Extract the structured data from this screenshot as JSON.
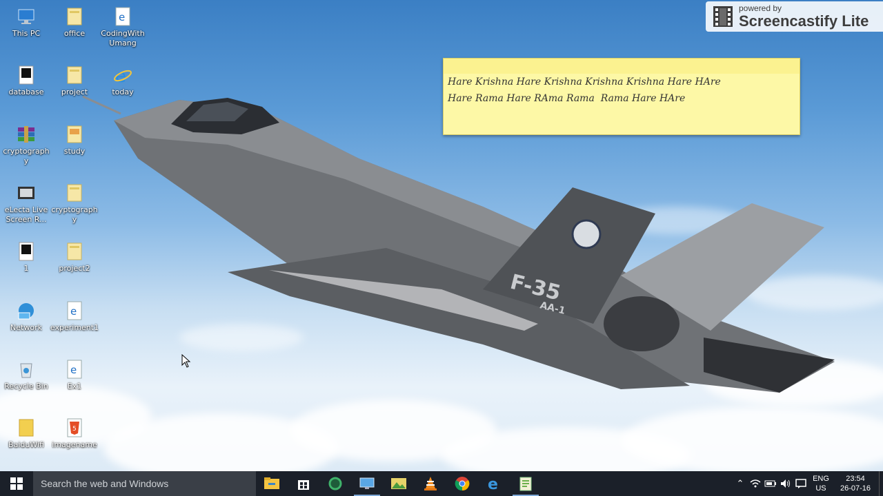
{
  "desktop": {
    "icons": [
      {
        "label": "This PC",
        "icon": "computer-icon"
      },
      {
        "label": "office",
        "icon": "folder-icon"
      },
      {
        "label": "CodingWith Umang",
        "icon": "edge-html-file-icon"
      },
      {
        "label": "database",
        "icon": "black-app-icon"
      },
      {
        "label": "project",
        "icon": "folder-icon"
      },
      {
        "label": "today",
        "icon": "internet-explorer-icon"
      },
      {
        "label": "cryptography",
        "icon": "winrar-icon"
      },
      {
        "label": "study",
        "icon": "folder-icon"
      },
      {
        "label": "eLecta Live Screen R...",
        "icon": "film-icon"
      },
      {
        "label": "cryptography",
        "icon": "folder-icon"
      },
      {
        "label": "1",
        "icon": "black-app-icon"
      },
      {
        "label": "project2",
        "icon": "folder-icon"
      },
      {
        "label": "Network",
        "icon": "network-icon"
      },
      {
        "label": "experiment1",
        "icon": "edge-html-file-icon"
      },
      {
        "label": "Recycle Bin",
        "icon": "recycle-bin-icon"
      },
      {
        "label": "Ex1",
        "icon": "edge-html-file-icon"
      },
      {
        "label": "BaiduWifi",
        "icon": "folder-icon"
      },
      {
        "label": "imagename",
        "icon": "html5-icon"
      }
    ]
  },
  "watermark": {
    "small": "powered by",
    "big": "Screencastify Lite"
  },
  "sticky_note": {
    "line1": "Hare Krishna Hare Krishna Krishna Krishna Hare HAre",
    "line2": "Hare Rama Hare RAma Rama  Rama Hare HAre"
  },
  "taskbar": {
    "search_placeholder": "Search the web and Windows",
    "apps": [
      "file-explorer-icon",
      "store-icon",
      "cortana-circle-icon",
      "remote-desktop-icon",
      "photos-icon",
      "vlc-icon",
      "chrome-icon",
      "edge-icon",
      "notepad-plus-icon"
    ],
    "language_top": "ENG",
    "language_bottom": "US",
    "time": "23:54",
    "date": "26-07-16"
  },
  "colors": {
    "taskbar": "#1b2029",
    "search_box": "#3a3f47",
    "sticky": "#fdf8a6"
  }
}
